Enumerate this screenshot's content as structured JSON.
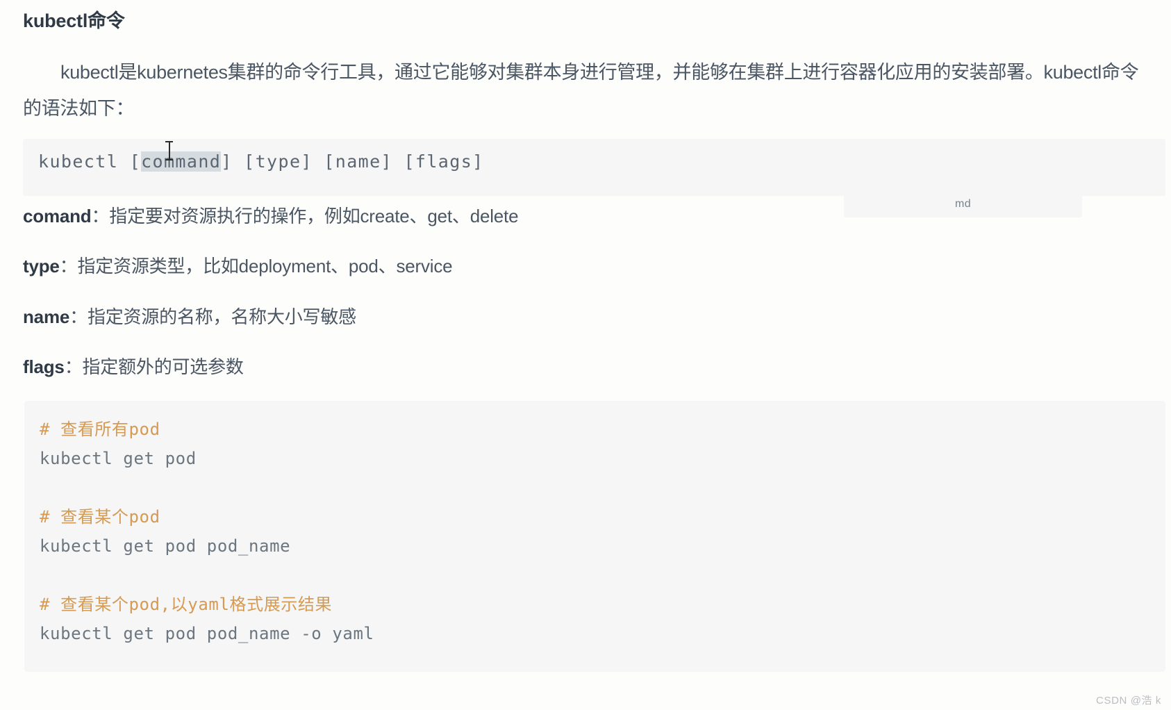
{
  "document": {
    "title": "kubectl命令",
    "intro": "kubectl是kubernetes集群的命令行工具，通过它能够对集群本身进行管理，并能够在集群上进行容器化应用的安装部署。kubectl命令的语法如下："
  },
  "syntax_block": {
    "prefix": "kubectl [",
    "selected": "command",
    "suffix": "] [type] [name] [flags]",
    "selection_highlight_color": "#d6dbe0"
  },
  "md_badge": {
    "label": "md"
  },
  "definitions": [
    {
      "term": "comand",
      "separator": "：",
      "description": "指定要对资源执行的操作，例如create、get、delete"
    },
    {
      "term": "type",
      "separator": "：",
      "description": "指定资源类型，比如deployment、pod、service"
    },
    {
      "term": "name",
      "separator": "：",
      "description": "指定资源的名称，名称大小写敏感"
    },
    {
      "term": "flags",
      "separator": "：",
      "description": "指定额外的可选参数"
    }
  ],
  "example_code_block": {
    "language": "shell",
    "comment_color": "#d59a54",
    "code_color": "#6b7680",
    "lines": [
      {
        "type": "comment",
        "text": "# 查看所有pod"
      },
      {
        "type": "code",
        "text": "kubectl get pod"
      },
      {
        "type": "blank",
        "text": " "
      },
      {
        "type": "comment",
        "text": "# 查看某个pod"
      },
      {
        "type": "code",
        "text": "kubectl get pod pod_name"
      },
      {
        "type": "blank",
        "text": " "
      },
      {
        "type": "comment",
        "text": "# 查看某个pod,以yaml格式展示结果"
      },
      {
        "type": "code",
        "text": "kubectl get pod pod_name -o yaml"
      }
    ]
  },
  "watermark": {
    "text": "CSDN @浩 k"
  }
}
